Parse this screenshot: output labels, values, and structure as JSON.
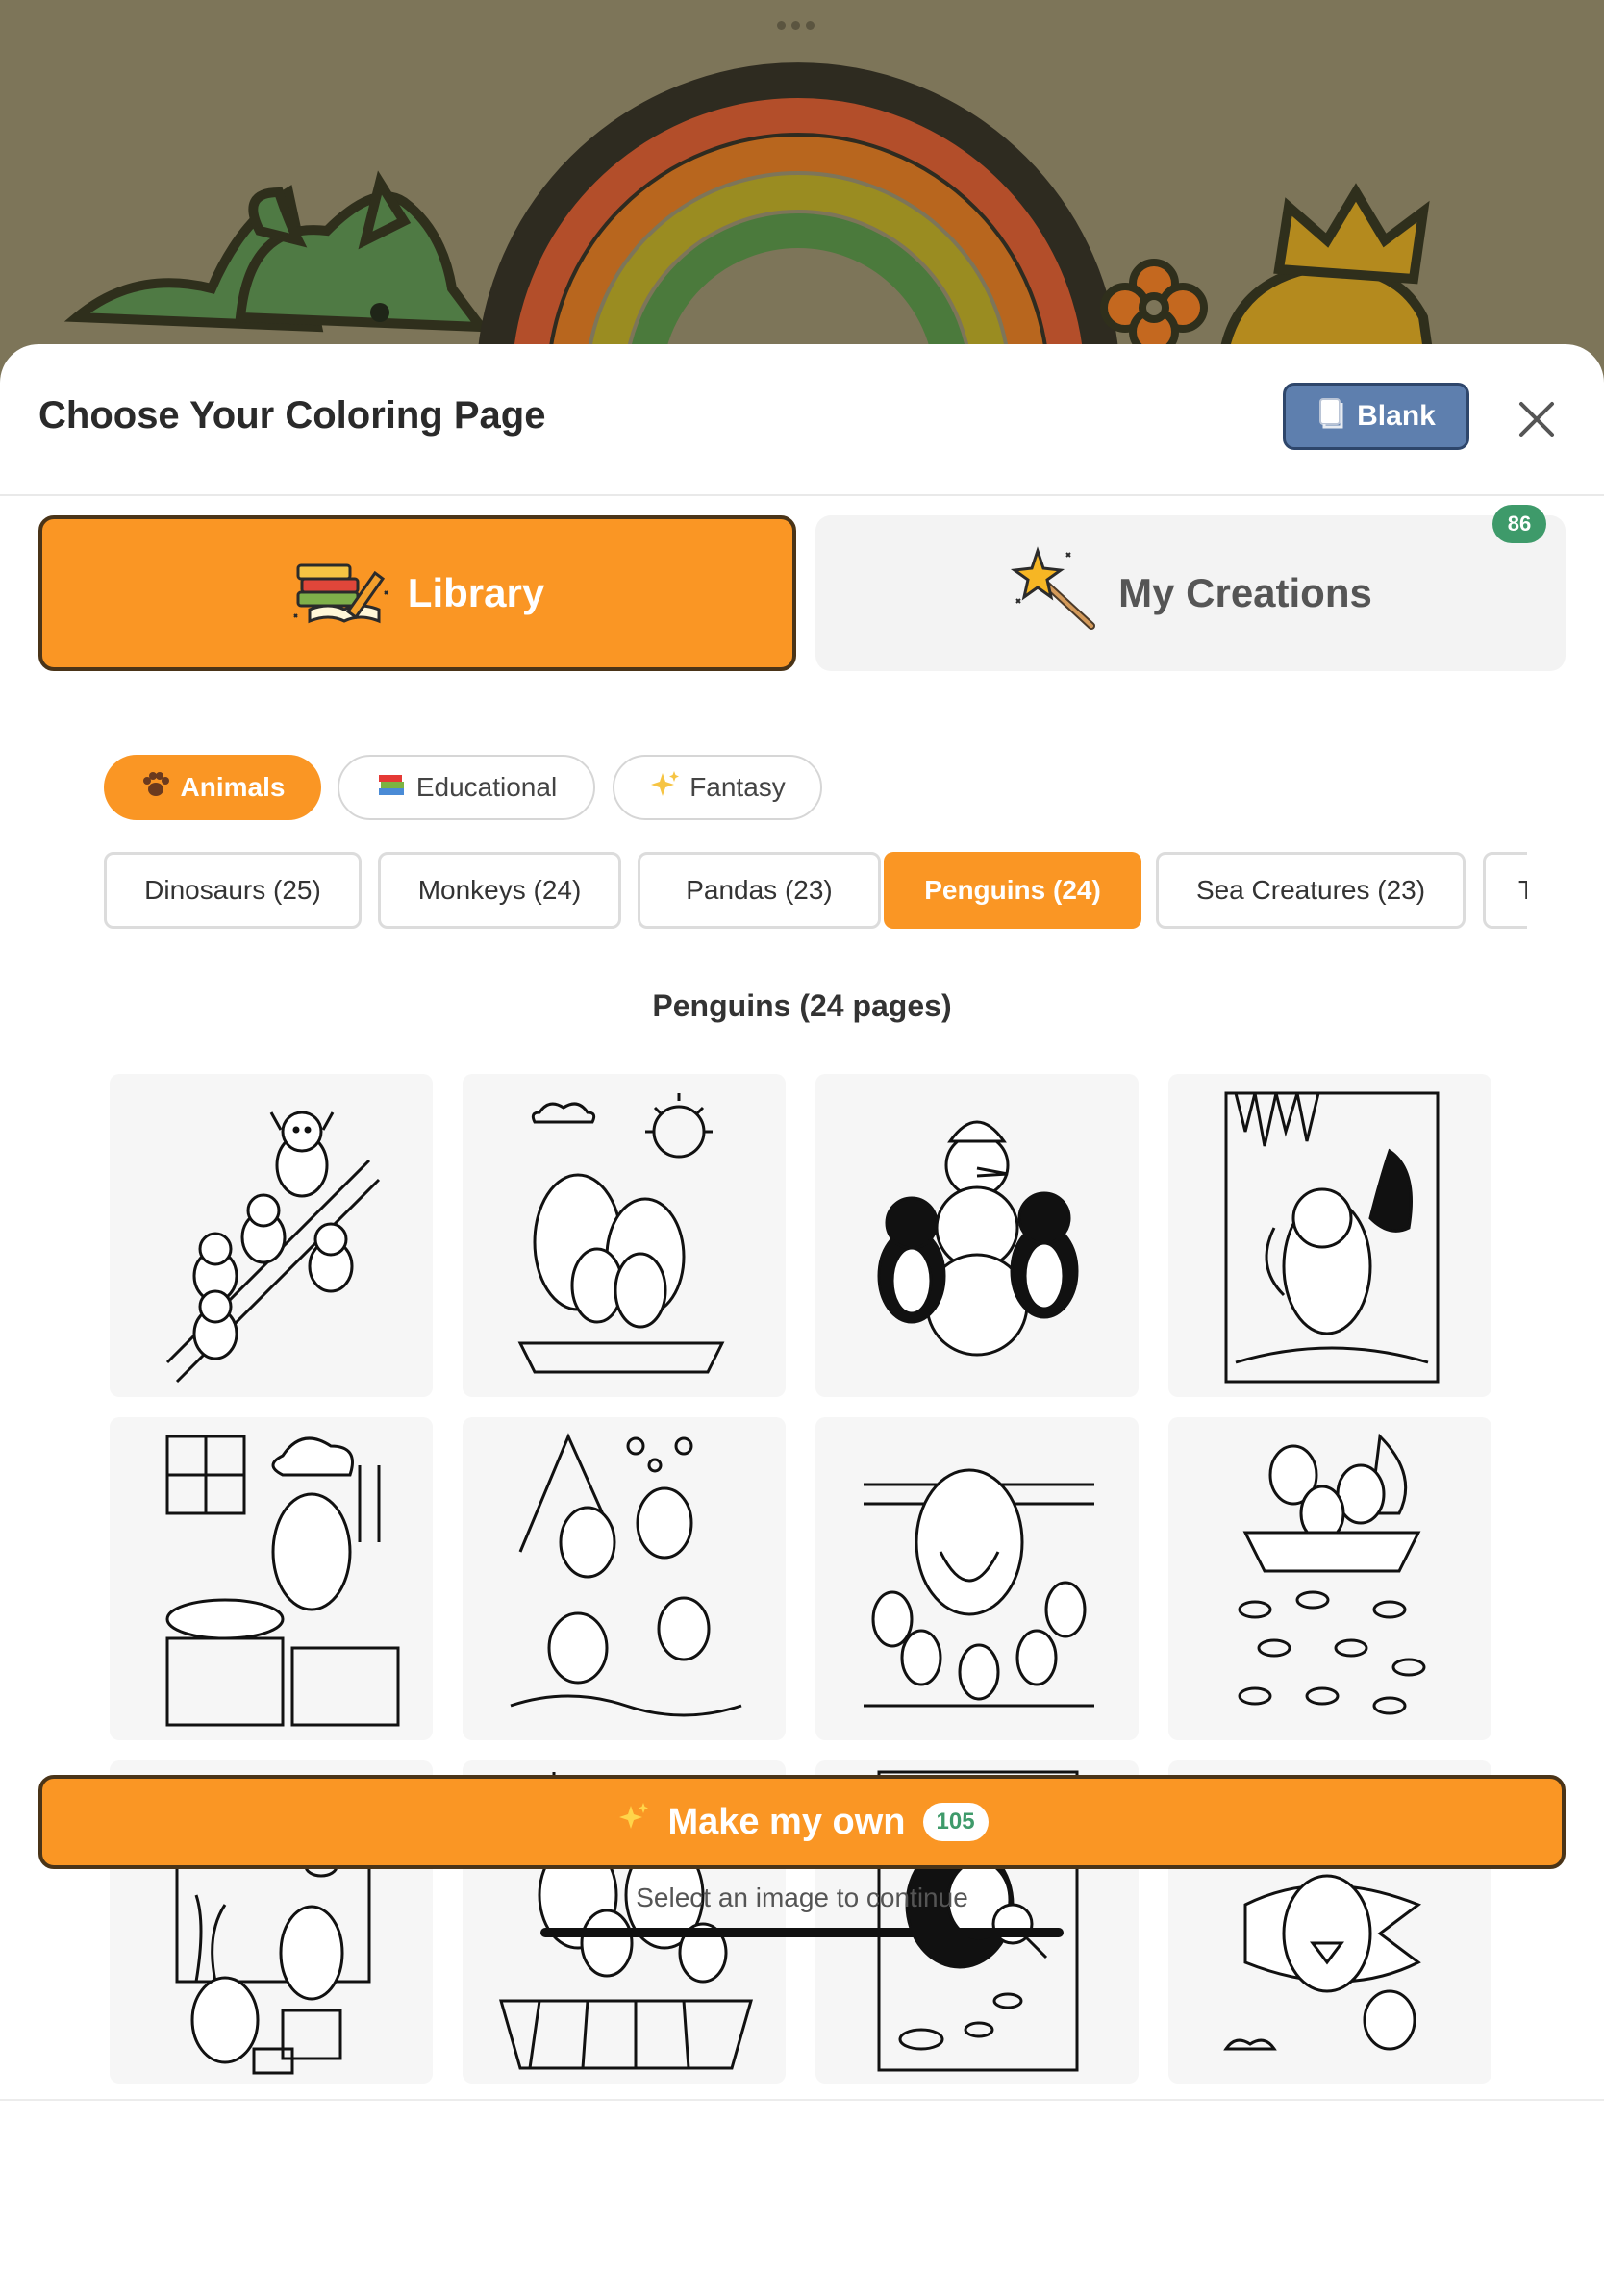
{
  "header": {
    "title": "Choose Your Coloring Page",
    "blank_label": "Blank"
  },
  "tabs": [
    {
      "label": "Library",
      "icon": "books-pencil-icon",
      "active": true
    },
    {
      "label": "My Creations",
      "icon": "magic-wand-icon",
      "active": false,
      "badge": "86"
    }
  ],
  "categories": [
    {
      "label": "Animals",
      "icon": "paw-icon",
      "active": true
    },
    {
      "label": "Educational",
      "icon": "books-icon",
      "active": false
    },
    {
      "label": "Fantasy",
      "icon": "sparkles-icon",
      "active": false
    }
  ],
  "subcategories": [
    {
      "label": "Dinosaurs (25)",
      "active": false
    },
    {
      "label": "Monkeys (24)",
      "active": false
    },
    {
      "label": "Pandas (23)",
      "active": false
    },
    {
      "label": "Penguins (24)",
      "active": true
    },
    {
      "label": "Sea Creatures (23)",
      "active": false
    },
    {
      "label": "T",
      "active": false
    }
  ],
  "section_title": "Penguins (24 pages)",
  "pages": [
    {
      "subject": "penguins sledding down hill"
    },
    {
      "subject": "penguin family on ice floe with sun"
    },
    {
      "subject": "penguins with snowman"
    },
    {
      "subject": "penguin explorer in ice cave"
    },
    {
      "subject": "penguin chef cooking fish"
    },
    {
      "subject": "penguins splashing in water"
    },
    {
      "subject": "grandpa penguin telling story"
    },
    {
      "subject": "penguins on boat with fish"
    },
    {
      "subject": "penguins at aquarium painting"
    },
    {
      "subject": "penguin family picnic"
    },
    {
      "subject": "detective penguin with magnifier"
    },
    {
      "subject": "superhero penguins flying"
    }
  ],
  "footer": {
    "make_label": "Make my own",
    "make_count": "105",
    "hint": "Select an image to continue"
  },
  "colors": {
    "accent": "#fa9624",
    "blank_button": "#5e7fae",
    "badge_green": "#3e9a6a"
  }
}
